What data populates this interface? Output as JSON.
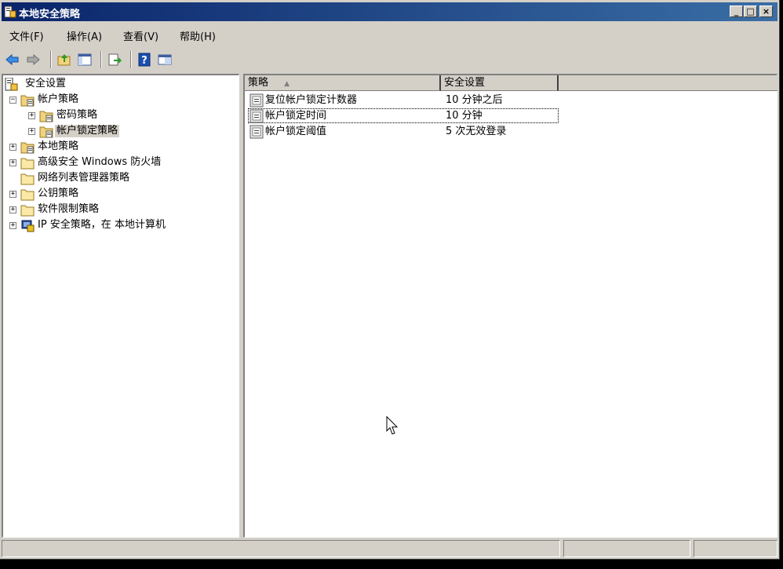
{
  "window": {
    "title": "本地安全策略",
    "buttons": {
      "minimize": "_",
      "maximize": "□",
      "close": "×"
    }
  },
  "menubar": {
    "items": [
      {
        "label": "文件(F)"
      },
      {
        "label": "操作(A)"
      },
      {
        "label": "查看(V)"
      },
      {
        "label": "帮助(H)"
      }
    ]
  },
  "toolbar": {
    "icons": [
      "back-arrow-icon",
      "forward-arrow-icon",
      "up-folder-icon",
      "show-hide-tree-icon",
      "export-list-icon",
      "help-icon",
      "console-view-icon"
    ]
  },
  "tree": {
    "root": "安全设置",
    "nodes": [
      {
        "label": "帐户策略",
        "expander": "−",
        "icon": "folder-policy-icon"
      },
      {
        "label": "密码策略",
        "expander": "+",
        "icon": "folder-policy-icon"
      },
      {
        "label": "帐户锁定策略",
        "expander": "+",
        "icon": "folder-policy-icon",
        "selected": true
      },
      {
        "label": "本地策略",
        "expander": "+",
        "icon": "folder-policy-icon"
      },
      {
        "label": "高级安全 Windows 防火墙",
        "expander": "+",
        "icon": "folder-icon"
      },
      {
        "label": "网络列表管理器策略",
        "expander": "",
        "icon": "folder-icon"
      },
      {
        "label": "公钥策略",
        "expander": "+",
        "icon": "folder-icon"
      },
      {
        "label": "软件限制策略",
        "expander": "+",
        "icon": "folder-icon"
      },
      {
        "label": "IP 安全策略，在 本地计算机",
        "expander": "+",
        "icon": "ip-security-icon"
      }
    ]
  },
  "list": {
    "columns": {
      "policy": "策略",
      "setting": "安全设置",
      "sort_indicator": "▲"
    },
    "rows": [
      {
        "policy": "复位帐户锁定计数器",
        "setting": "10 分钟之后"
      },
      {
        "policy": "帐户锁定时间",
        "setting": "10 分钟"
      },
      {
        "policy": "帐户锁定阈值",
        "setting": "5 次无效登录"
      }
    ]
  },
  "colors": {
    "titlebar_start": "#0a246a",
    "titlebar_end": "#3a6ea5",
    "chrome": "#d4d0c8"
  }
}
